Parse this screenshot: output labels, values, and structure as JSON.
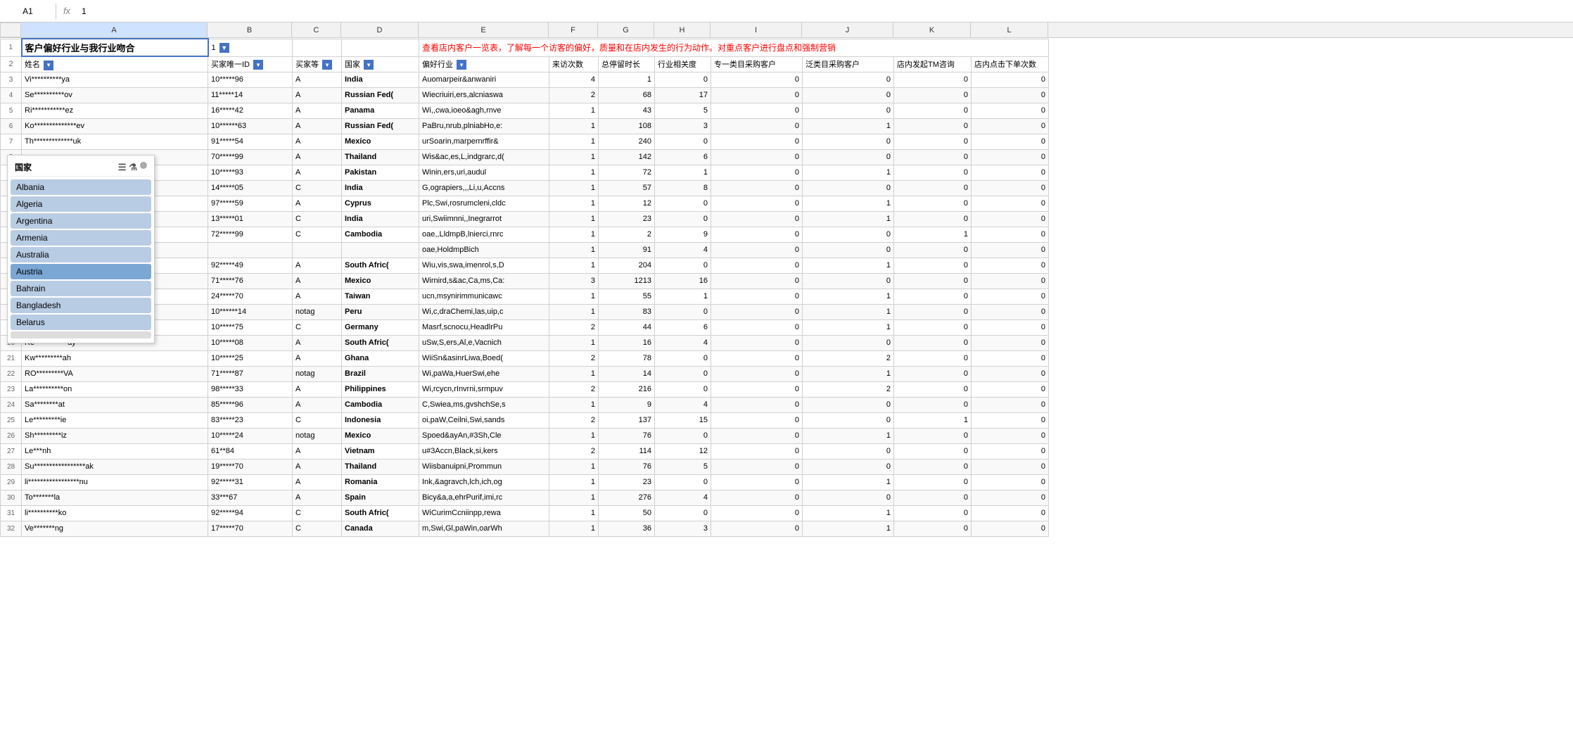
{
  "formula_bar": {
    "cell_ref": "A1",
    "content": "1"
  },
  "col_headers": [
    "",
    "A",
    "B",
    "C",
    "D",
    "E",
    "F",
    "G",
    "H",
    "I",
    "J",
    "K",
    "L"
  ],
  "row1": {
    "title": "客户偏好行业与我行业吻合",
    "filter_value": "1",
    "description": "查看店内客户一览表，了解每一个访客的偏好，质量和在店内发生的行为动作。对重点客户进行盘点和强制营销"
  },
  "col_names": {
    "a": "姓名",
    "b": "买家唯一ID",
    "c": "买家等",
    "d": "国家",
    "e": "偏好行业",
    "f": "来访次数",
    "g": "总停留时长",
    "h": "行业相关度",
    "i": "专一类目采购客户",
    "j": "泛类目采购客户",
    "k": "店内发起TM咨询",
    "l": "店内点击下单次数"
  },
  "dropdown": {
    "title": "国家",
    "items": [
      "Albania",
      "Algeria",
      "Argentina",
      "Armenia",
      "Australia",
      "Austria",
      "Bahrain",
      "Bangladesh",
      "Belarus"
    ]
  },
  "rows": [
    {
      "name": "Vi**********ya",
      "id": "10*****96",
      "grade": "A",
      "country": "India",
      "industry": "Auomarpeir&anwaniri",
      "visits": 4,
      "duration": 1,
      "relevance": 0,
      "specialist": 0,
      "general": 0,
      "tm": 0,
      "orders": 0
    },
    {
      "name": "Se**********ov",
      "id": "11*****14",
      "grade": "A",
      "country": "Russian Fed(",
      "industry": "Wiecriuiri,ers,alcniaswa",
      "visits": 2,
      "duration": 68,
      "relevance": 17,
      "specialist": 0,
      "general": 0,
      "tm": 0,
      "orders": 0
    },
    {
      "name": "Ri***********ez",
      "id": "16*****42",
      "grade": "A",
      "country": "Panama",
      "industry": "Wi,,cwa,ioeo&agh,rnve",
      "visits": 1,
      "duration": 43,
      "relevance": 5,
      "specialist": 0,
      "general": 0,
      "tm": 0,
      "orders": 0
    },
    {
      "name": "Ko**************ev",
      "id": "10******63",
      "grade": "A",
      "country": "Russian Fed(",
      "industry": "PaBru,nrub,plniabHo,e:",
      "visits": 1,
      "duration": 108,
      "relevance": 3,
      "specialist": 0,
      "general": 1,
      "tm": 0,
      "orders": 0
    },
    {
      "name": "Th*************uk",
      "id": "91*****54",
      "grade": "A",
      "country": "Mexico",
      "industry": "urSoarin,marpernrffir&",
      "visits": 1,
      "duration": 240,
      "relevance": 0,
      "specialist": 0,
      "general": 0,
      "tm": 0,
      "orders": 0
    },
    {
      "name": "",
      "id": "70*****99",
      "grade": "A",
      "country": "Thailand",
      "industry": "Wis&ac,es,L,indgrarc,d(",
      "visits": 1,
      "duration": 142,
      "relevance": 6,
      "specialist": 0,
      "general": 0,
      "tm": 0,
      "orders": 0
    },
    {
      "name": "",
      "id": "10*****93",
      "grade": "A",
      "country": "Pakistan",
      "industry": "Winin,ers,uri,audul",
      "visits": 1,
      "duration": 72,
      "relevance": 1,
      "specialist": 0,
      "general": 1,
      "tm": 0,
      "orders": 0
    },
    {
      "name": "",
      "id": "14*****05",
      "grade": "C",
      "country": "India",
      "industry": "G,ograpiers,,,Li,u,Accns",
      "visits": 1,
      "duration": 57,
      "relevance": 8,
      "specialist": 0,
      "general": 0,
      "tm": 0,
      "orders": 0
    },
    {
      "name": "",
      "id": "97*****59",
      "grade": "A",
      "country": "Cyprus",
      "industry": "Plc,Swi,rosrumcleni,cldc",
      "visits": 1,
      "duration": 12,
      "relevance": 0,
      "specialist": 0,
      "general": 1,
      "tm": 0,
      "orders": 0
    },
    {
      "name": "",
      "id": "13*****01",
      "grade": "C",
      "country": "India",
      "industry": "uri,Swiimnni,,Inegrarrot",
      "visits": 1,
      "duration": 23,
      "relevance": 0,
      "specialist": 0,
      "general": 1,
      "tm": 0,
      "orders": 0
    },
    {
      "name": "",
      "id": "72*****99",
      "grade": "C",
      "country": "Cambodia",
      "industry": "oae,,LldmpB,lnierci,rnrc",
      "visits": 1,
      "duration": 2,
      "relevance": 9,
      "specialist": 0,
      "general": 0,
      "tm": 1,
      "orders": 0
    },
    {
      "name": "",
      "id": "",
      "grade": "",
      "country": "",
      "industry": "oae,HoldmpBich",
      "visits": 1,
      "duration": 91,
      "relevance": 4,
      "specialist": 0,
      "general": 0,
      "tm": 0,
      "orders": 0
    },
    {
      "name": "",
      "id": "92*****49",
      "grade": "A",
      "country": "South Afric(",
      "industry": "Wiu,vis,swa,imenrol,s,D",
      "visits": 1,
      "duration": 204,
      "relevance": 0,
      "specialist": 0,
      "general": 1,
      "tm": 0,
      "orders": 0
    },
    {
      "name": "",
      "id": "71*****76",
      "grade": "A",
      "country": "Mexico",
      "industry": "Wirnird,s&ac,Ca,ms,Ca:",
      "visits": 3,
      "duration": 1213,
      "relevance": 16,
      "specialist": 0,
      "general": 0,
      "tm": 0,
      "orders": 0
    },
    {
      "name": "",
      "id": "24*****70",
      "grade": "A",
      "country": "Taiwan",
      "industry": "ucn,msynirimmunicawc",
      "visits": 1,
      "duration": 55,
      "relevance": 1,
      "specialist": 0,
      "general": 1,
      "tm": 0,
      "orders": 0
    },
    {
      "name": "",
      "id": "10******14",
      "grade": "notag",
      "country": "Peru",
      "industry": "Wi,c,draChemi,las,uip,c",
      "visits": 1,
      "duration": 83,
      "relevance": 0,
      "specialist": 0,
      "general": 1,
      "tm": 0,
      "orders": 0
    },
    {
      "name": "",
      "id": "10*****75",
      "grade": "C",
      "country": "Germany",
      "industry": "Masrf,scnocu,HeadlrPu",
      "visits": 2,
      "duration": 44,
      "relevance": 6,
      "specialist": 0,
      "general": 1,
      "tm": 0,
      "orders": 0
    },
    {
      "name": "Re***********ay",
      "id": "10*****08",
      "grade": "A",
      "country": "South Afric(",
      "industry": "uSw,S,ers,Al,e,Vacnich",
      "visits": 1,
      "duration": 16,
      "relevance": 4,
      "specialist": 0,
      "general": 0,
      "tm": 0,
      "orders": 0
    },
    {
      "name": "Kw*********ah",
      "id": "10*****25",
      "grade": "A",
      "country": "Ghana",
      "industry": "WiiSn&asinrLiwa,Boed(",
      "visits": 2,
      "duration": 78,
      "relevance": 0,
      "specialist": 0,
      "general": 2,
      "tm": 0,
      "orders": 0
    },
    {
      "name": "RO*********VA",
      "id": "71*****87",
      "grade": "notag",
      "country": "Brazil",
      "industry": "Wi,paWa,HuerSwi,ehe",
      "visits": 1,
      "duration": 14,
      "relevance": 0,
      "specialist": 0,
      "general": 1,
      "tm": 0,
      "orders": 0
    },
    {
      "name": "La**********on",
      "id": "98*****33",
      "grade": "A",
      "country": "Philippines",
      "industry": "Wi,rcycn,rInvrni,srmpuv",
      "visits": 2,
      "duration": 216,
      "relevance": 0,
      "specialist": 0,
      "general": 2,
      "tm": 0,
      "orders": 0
    },
    {
      "name": "Sa********at",
      "id": "85*****96",
      "grade": "A",
      "country": "Cambodia",
      "industry": "C,Swiea,ms,gvshchSe,s",
      "visits": 1,
      "duration": 9,
      "relevance": 4,
      "specialist": 0,
      "general": 0,
      "tm": 0,
      "orders": 0
    },
    {
      "name": "Le*********ie",
      "id": "83*****23",
      "grade": "C",
      "country": "Indonesia",
      "industry": "oi,paW,Ceilni,Swi,sands",
      "visits": 2,
      "duration": 137,
      "relevance": 15,
      "specialist": 0,
      "general": 0,
      "tm": 1,
      "orders": 0
    },
    {
      "name": "Sh*********iz",
      "id": "10*****24",
      "grade": "notag",
      "country": "Mexico",
      "industry": "Spoed&ayAn,#3Sh,Cle",
      "visits": 1,
      "duration": 76,
      "relevance": 0,
      "specialist": 0,
      "general": 1,
      "tm": 0,
      "orders": 0
    },
    {
      "name": "Le***nh",
      "id": "61**84",
      "grade": "A",
      "country": "Vietnam",
      "industry": "u#3Accn,Black,si,kers",
      "visits": 2,
      "duration": 114,
      "relevance": 12,
      "specialist": 0,
      "general": 0,
      "tm": 0,
      "orders": 0
    },
    {
      "name": "Su*****************ak",
      "id": "19*****70",
      "grade": "A",
      "country": "Thailand",
      "industry": "Wiisbanuipni,Prommun",
      "visits": 1,
      "duration": 76,
      "relevance": 5,
      "specialist": 0,
      "general": 0,
      "tm": 0,
      "orders": 0
    },
    {
      "name": "li*****************nu",
      "id": "92*****31",
      "grade": "A",
      "country": "Romania",
      "industry": "Ink,&agravch,lch,ich,og",
      "visits": 1,
      "duration": 23,
      "relevance": 0,
      "specialist": 0,
      "general": 1,
      "tm": 0,
      "orders": 0
    },
    {
      "name": "To*******la",
      "id": "33***67",
      "grade": "A",
      "country": "Spain",
      "industry": "Bicy&a,a,ehrPurif,imi,rc",
      "visits": 1,
      "duration": 276,
      "relevance": 4,
      "specialist": 0,
      "general": 0,
      "tm": 0,
      "orders": 0
    },
    {
      "name": "li**********ko",
      "id": "92*****94",
      "grade": "C",
      "country": "South Afric(",
      "industry": "WiCurimCcniinpp,rewa",
      "visits": 1,
      "duration": 50,
      "relevance": 0,
      "specialist": 0,
      "general": 1,
      "tm": 0,
      "orders": 0
    },
    {
      "name": "Ve*******ng",
      "id": "17*****70",
      "grade": "C",
      "country": "Canada",
      "industry": "m,Swi,Gl,paWin,oarWh",
      "visits": 1,
      "duration": 36,
      "relevance": 3,
      "specialist": 0,
      "general": 1,
      "tm": 0,
      "orders": 0
    }
  ]
}
